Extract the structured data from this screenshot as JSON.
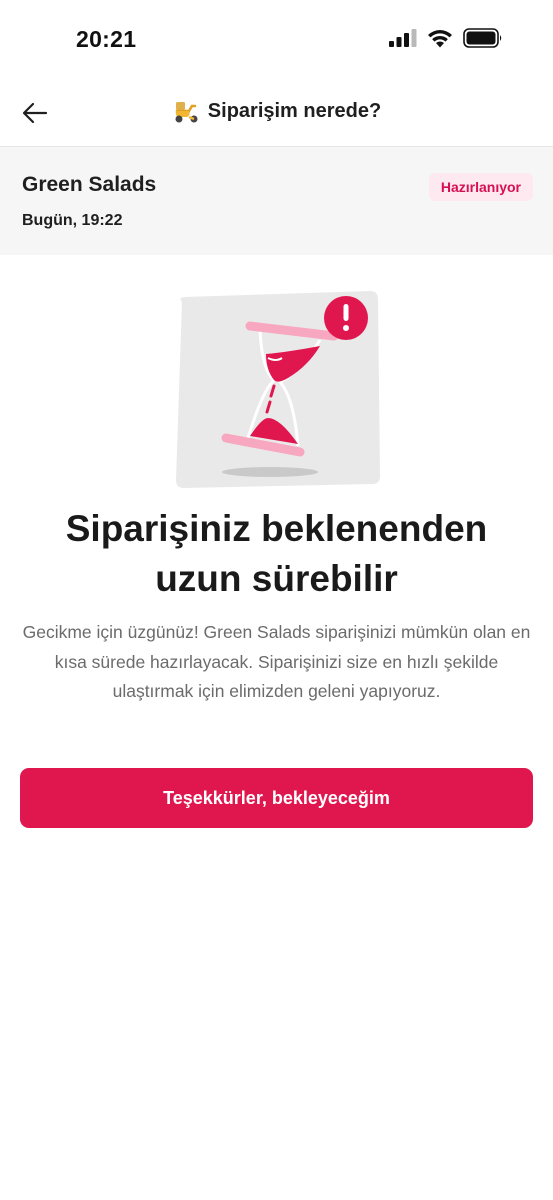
{
  "status_bar": {
    "time": "20:21",
    "icons": [
      "signal-icon",
      "wifi-icon",
      "battery-icon"
    ]
  },
  "header": {
    "back_icon": "arrow-left-icon",
    "title_icon": "scooter-icon",
    "title": "Siparişim nerede?"
  },
  "order": {
    "restaurant": "Green Salads",
    "time": "Bugün, 19:22",
    "status": "Hazırlanıyor"
  },
  "message": {
    "illustration_icon": "hourglass-warning-icon",
    "headline": "Siparişiniz beklenenden uzun sürebilir",
    "body": "Gecikme için üzgünüz! Green Salads siparişinizi mümkün olan en kısa sürede hazırlayacak. Siparişinizi size en hızlı şekilde ulaştırmak için elimizden geleni yapıyoruz."
  },
  "actions": {
    "confirm_label": "Teşekkürler, bekleyeceğim"
  },
  "colors": {
    "brand": "#E0174F",
    "badge_bg": "#FDE9EF",
    "badge_text": "#D70F53",
    "card_bg": "#F6F6F6",
    "body_text": "#6B6B6B"
  }
}
